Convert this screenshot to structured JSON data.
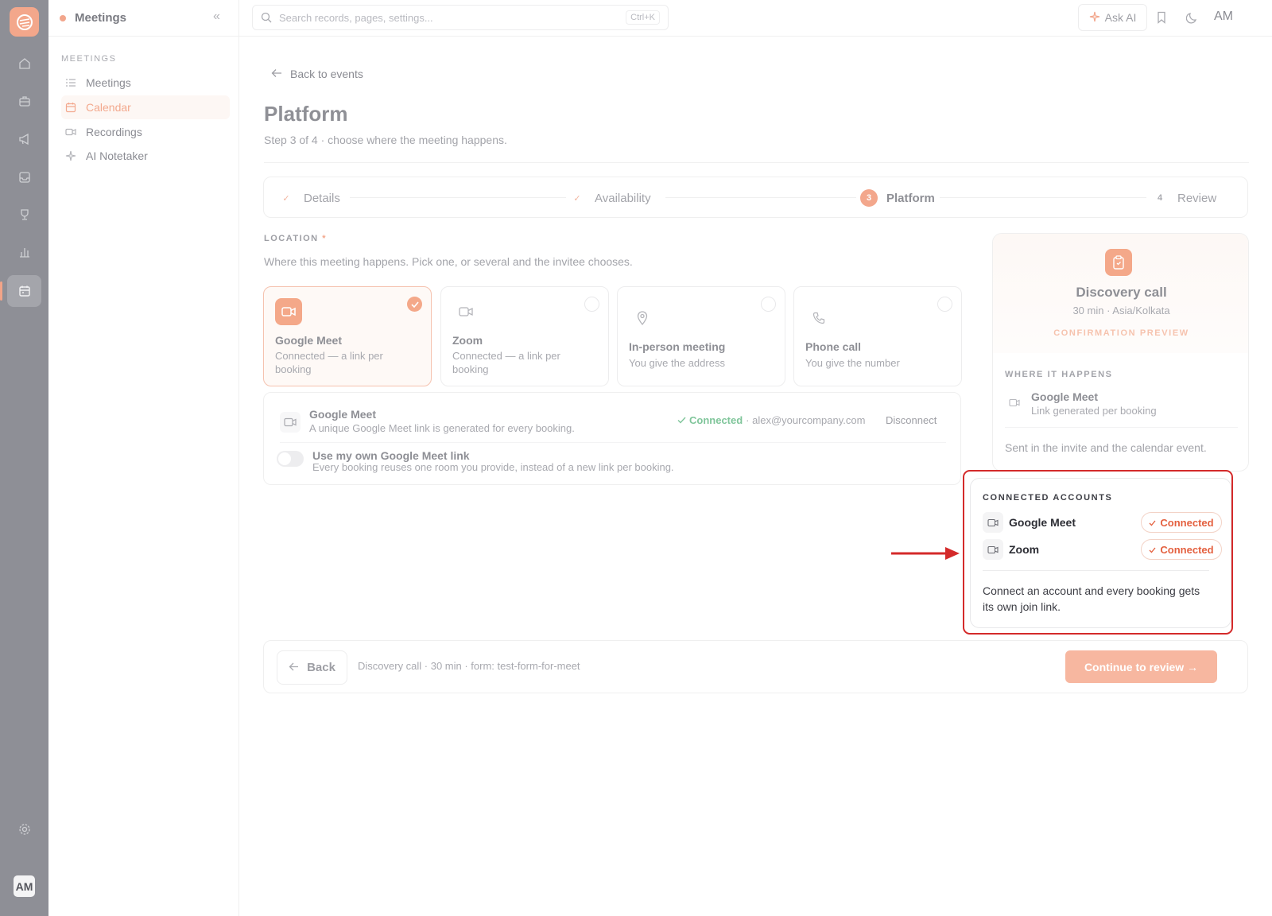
{
  "app": {
    "section_title": "Meetings",
    "user_initials": "AM"
  },
  "rail": {
    "items": [
      "home-icon",
      "briefcase-icon",
      "megaphone-icon",
      "inbox-icon",
      "trophy-icon",
      "chart-icon",
      "calendar-icon"
    ],
    "active": "calendar-icon",
    "bottom": [
      "gear-icon"
    ]
  },
  "sidebar": {
    "title": "Meetings",
    "section_label": "MEETINGS",
    "items": [
      {
        "label": "Meetings",
        "icon": "list-icon"
      },
      {
        "label": "Calendar",
        "icon": "calendar-icon",
        "active": true
      },
      {
        "label": "Recordings",
        "icon": "video-icon"
      },
      {
        "label": "AI Notetaker",
        "icon": "sparkle-icon"
      }
    ]
  },
  "topbar": {
    "search_placeholder": "Search records, pages, settings...",
    "shortcut": "Ctrl+K",
    "ask_ai": "Ask AI",
    "user_initials": "AM"
  },
  "page": {
    "back_link": "Back to events",
    "title": "Platform",
    "subtitle": "Step 3 of 4 · choose where the meeting happens."
  },
  "stepper": {
    "steps": [
      {
        "label": "Details",
        "marker": "✓",
        "state": "done"
      },
      {
        "label": "Availability",
        "marker": "✓",
        "state": "done"
      },
      {
        "label": "Platform",
        "marker": "3",
        "state": "current"
      },
      {
        "label": "Review",
        "marker": "4",
        "state": "todo"
      }
    ]
  },
  "location": {
    "label": "LOCATION",
    "required_mark": "*",
    "description": "Where this meeting happens. Pick one, or several and the invitee chooses.",
    "options": [
      {
        "title": "Google Meet",
        "subtitle": "Connected — a link per booking",
        "icon": "video-icon",
        "selected": true
      },
      {
        "title": "Zoom",
        "subtitle": "Connected — a link per booking",
        "icon": "video-icon",
        "selected": false
      },
      {
        "title": "In-person meeting",
        "subtitle": "You give the address",
        "icon": "map-pin-icon",
        "selected": false
      },
      {
        "title": "Phone call",
        "subtitle": "You give the number",
        "icon": "phone-icon",
        "selected": false
      }
    ]
  },
  "google_meet_panel": {
    "title": "Google Meet",
    "description": "A unique Google Meet link is generated for every booking.",
    "status": "Connected",
    "account": "· alex@yourcompany.com",
    "disconnect": "Disconnect",
    "own_link_title": "Use my own Google Meet link",
    "own_link_description": "Every booking reuses one room you provide, instead of a new link per booking.",
    "own_link_enabled": false
  },
  "preview": {
    "title": "Discovery call",
    "meta": "30 min · Asia/Kolkata",
    "label": "CONFIRMATION PREVIEW",
    "where_label": "WHERE IT HAPPENS",
    "where_name": "Google Meet",
    "where_sub": "Link generated per booking",
    "footer": "Sent in the invite and the calendar event."
  },
  "connected_accounts": {
    "heading": "CONNECTED ACCOUNTS",
    "accounts": [
      {
        "name": "Google Meet",
        "status": "Connected"
      },
      {
        "name": "Zoom",
        "status": "Connected"
      }
    ],
    "note": "Connect an account and every booking gets its own join link."
  },
  "footer": {
    "back": "Back",
    "info": "Discovery call · 30 min · form: test-form-for-meet",
    "continue": "Continue to review →"
  },
  "colors": {
    "accent": "#f3a78c",
    "highlight": "#d42a2a",
    "connected_green": "#7fc59a",
    "badge_text": "#e4603f"
  }
}
